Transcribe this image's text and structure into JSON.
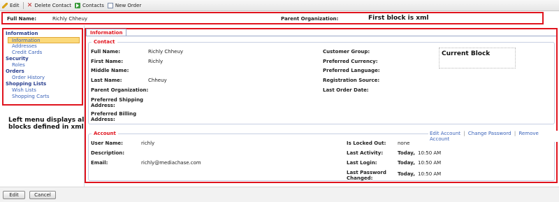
{
  "toolbar": {
    "edit": "Edit",
    "delete_contact": "Delete Contact",
    "contacts": "Contacts",
    "new_order": "New Order"
  },
  "header": {
    "full_name_label": "Full Name:",
    "full_name_value": "Richly Chheuy",
    "parent_org_label": "Parent Organization:",
    "annotation": "First block is xml"
  },
  "left_menu": {
    "sections": [
      {
        "title": "Information",
        "items": [
          "Information",
          "Addresses",
          "Credit Cards"
        ]
      },
      {
        "title": "Security",
        "items": [
          "Roles"
        ]
      },
      {
        "title": "Orders",
        "items": [
          "Order History"
        ]
      },
      {
        "title": "Shopping Lists",
        "items": [
          "Wish Lists",
          "Shopping Carts"
        ]
      }
    ],
    "annotation_line1": "Left menu displays all",
    "annotation_line2": "blocks defined in xml"
  },
  "main": {
    "tab": "Information",
    "contact": {
      "legend": "Contact",
      "fields": {
        "full_name_label": "Full Name:",
        "full_name_value": "Richly Chheuy",
        "first_name_label": "First Name:",
        "first_name_value": "Richly",
        "middle_name_label": "Middle Name:",
        "last_name_label": "Last Name:",
        "last_name_value": "Chheuy",
        "parent_org_label": "Parent Organization:",
        "pref_shipping_label_1": "Preferred Shipping",
        "pref_shipping_label_2": "Address:",
        "pref_billing_label_1": "Preferred Billing",
        "pref_billing_label_2": "Address:",
        "customer_group_label": "Customer Group:",
        "pref_currency_label": "Preferred Currency:",
        "pref_language_label": "Preferred Language:",
        "registration_source_label": "Registration Source:",
        "last_order_date_label": "Last Order Date:"
      },
      "annotation": "Current Block"
    },
    "account": {
      "legend": "Account",
      "links": [
        "Edit Account",
        "Change Password",
        "Remove Account"
      ],
      "separator": "|",
      "fields": {
        "user_name_label": "User Name:",
        "user_name_value": "richly",
        "description_label": "Description:",
        "email_label": "Email:",
        "email_value": "richly@mediachase.com",
        "locked_out_label": "Is Locked Out:",
        "locked_out_value": "none",
        "last_activity_label": "Last Activity:",
        "last_activity_day": "Today,",
        "last_activity_time": "10:50 AM",
        "last_login_label": "Last Login:",
        "last_login_day": "Today,",
        "last_login_time": "10:50 AM",
        "last_pw_label_1": "Last Password",
        "last_pw_label_2": "Changed:",
        "last_pw_day": "Today,",
        "last_pw_time": "10:50 AM"
      }
    }
  },
  "bottom": {
    "edit": "Edit",
    "cancel": "Cancel"
  }
}
